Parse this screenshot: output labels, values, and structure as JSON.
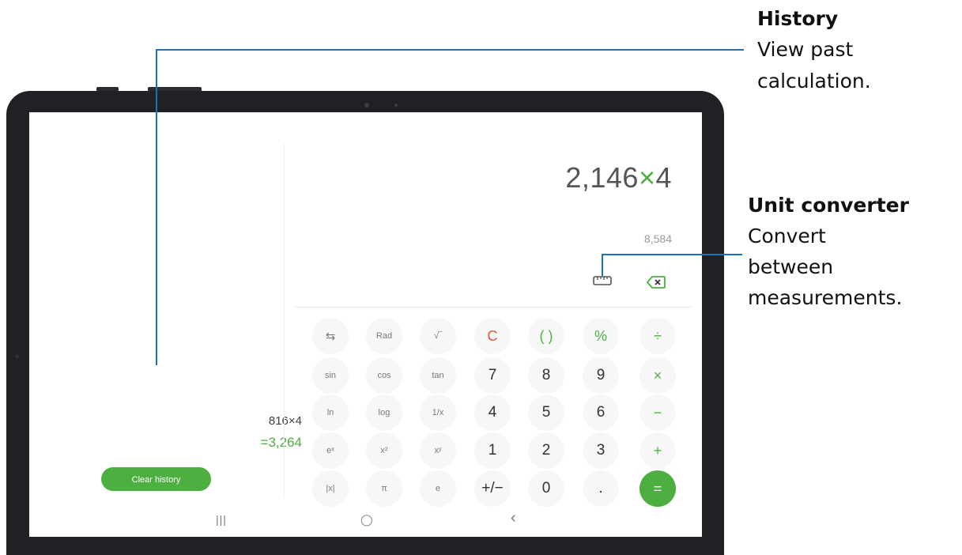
{
  "callouts": {
    "history": {
      "title": "History",
      "desc_line1": "View past",
      "desc_line2": "calculation."
    },
    "unit": {
      "title": "Unit converter",
      "desc_line1": "Convert",
      "desc_line2": "between",
      "desc_line3": "measurements."
    }
  },
  "history": {
    "expression": "816×4",
    "result": "=3,264",
    "clear_label": "Clear history"
  },
  "display": {
    "expr_left": "2,146",
    "expr_op": "×",
    "expr_right": "4",
    "preview": "8,584"
  },
  "icons": {
    "ruler": "ruler-icon",
    "backspace": "backspace-icon"
  },
  "keys": {
    "row1": [
      "⇆",
      "Rad",
      "√‾",
      "C",
      "( )",
      "%",
      "÷"
    ],
    "row2": [
      "sin",
      "cos",
      "tan",
      "7",
      "8",
      "9",
      "×"
    ],
    "row3": [
      "ln",
      "log",
      "1/x",
      "4",
      "5",
      "6",
      "−"
    ],
    "row4": [
      "eˣ",
      "x²",
      "xʸ",
      "1",
      "2",
      "3",
      "+"
    ],
    "row5": [
      "|x|",
      "π",
      "e",
      "+/−",
      "0",
      ".",
      "="
    ]
  },
  "nav": {
    "recents": "|||",
    "home": "◯",
    "back": "‹"
  },
  "colors": {
    "accent_green": "#4caf3f",
    "clear_red": "#e2563d",
    "callout_blue": "#1a73b8",
    "bezel": "#1f2124"
  }
}
